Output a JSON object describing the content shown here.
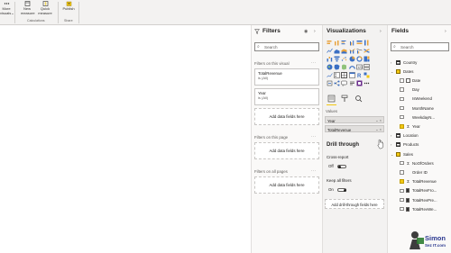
{
  "ribbon": {
    "more_visuals": {
      "line1": "More",
      "line2": "visuals"
    },
    "new_measure": {
      "line1": "New",
      "line2": "measure"
    },
    "quick_measure": {
      "line1": "Quick",
      "line2": "measure"
    },
    "publish": {
      "line1": "Publish"
    },
    "group_calculations": "Calculations",
    "group_share": "Share"
  },
  "filters": {
    "title": "Filters",
    "search_placeholder": "Search",
    "on_this_visual": "Filters on this visual",
    "card1": {
      "name": "TotalRevenue",
      "value": "is (All)"
    },
    "card2": {
      "name": "Year",
      "value": "is (All)"
    },
    "add_data_fields": "Add data fields here",
    "on_this_page": "Filters on this page",
    "on_all_pages": "Filters on all pages"
  },
  "visualizations": {
    "title": "Visualizations",
    "values_label": "Values",
    "wells": [
      "Year",
      "TotalRevenue"
    ],
    "drill_through": "Drill through",
    "cross_report": "Cross-report",
    "cross_report_state": "Off",
    "keep_all_filters": "Keep all filters",
    "keep_all_filters_state": "On",
    "add_drill_through": "Add drill-through fields here"
  },
  "fields": {
    "title": "Fields",
    "search_placeholder": "Search",
    "items": [
      {
        "label": "Country",
        "kind": "table",
        "level": 0,
        "expanded": false,
        "checked": false
      },
      {
        "label": "Dates",
        "kind": "table-highlight",
        "level": 0,
        "expanded": true,
        "checked": false
      },
      {
        "label": "Date",
        "kind": "field-hier",
        "level": 1,
        "checked": false
      },
      {
        "label": "Day",
        "kind": "field",
        "level": 1,
        "checked": false
      },
      {
        "label": "IsWeekend",
        "kind": "field",
        "level": 1,
        "checked": false
      },
      {
        "label": "MonthName",
        "kind": "field",
        "level": 1,
        "checked": false
      },
      {
        "label": "WeekdayN...",
        "kind": "field",
        "level": 1,
        "checked": false
      },
      {
        "label": "Year",
        "kind": "sigma",
        "level": 1,
        "checked": true
      },
      {
        "label": "Location",
        "kind": "table",
        "level": 0,
        "expanded": false,
        "checked": false
      },
      {
        "label": "Products",
        "kind": "table",
        "level": 0,
        "expanded": false,
        "checked": false
      },
      {
        "label": "Sales",
        "kind": "table-highlight",
        "level": 0,
        "expanded": true,
        "checked": false
      },
      {
        "label": "NoOfOrders",
        "kind": "sigma",
        "level": 1,
        "checked": false
      },
      {
        "label": "Order ID",
        "kind": "field",
        "level": 1,
        "checked": false
      },
      {
        "label": "TotalRevenue",
        "kind": "sigma",
        "level": 1,
        "checked": true
      },
      {
        "label": "TotalRevFro...",
        "kind": "calc",
        "level": 1,
        "checked": false
      },
      {
        "label": "TotalRevPre...",
        "kind": "calc",
        "level": 1,
        "checked": false
      },
      {
        "label": "TotalRevWe...",
        "kind": "calc",
        "level": 1,
        "checked": false
      }
    ]
  },
  "logo": {
    "line1": "Simon",
    "line2": "Sez IT.com"
  },
  "colors": {
    "accent_yellow": "#f2c811",
    "pane_bg": "#f3f2f1",
    "border": "#c8c6c4"
  }
}
